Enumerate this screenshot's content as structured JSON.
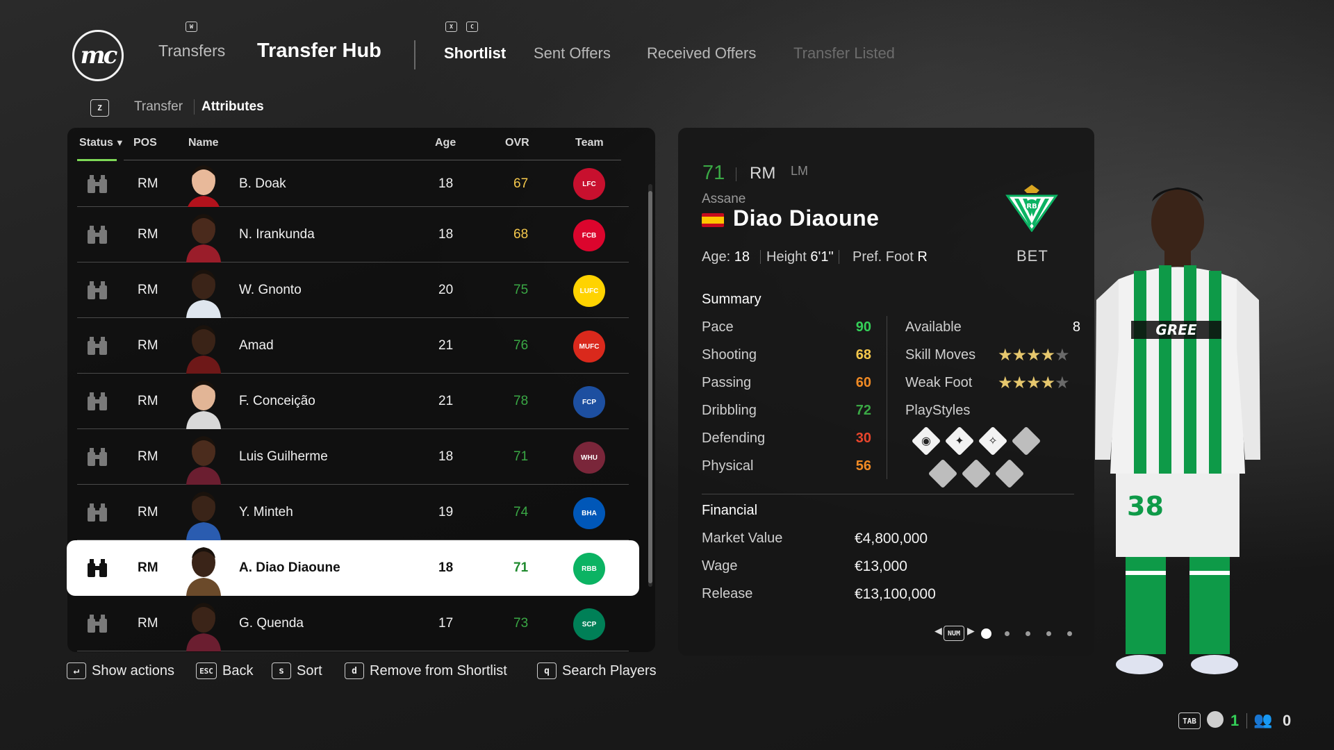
{
  "header": {
    "logo_text": "mc",
    "nav_key": "W",
    "transfers_label": "Transfers",
    "title": "Transfer Hub",
    "tab_keys": [
      "X",
      "C"
    ],
    "tabs": [
      {
        "label": "Shortlist",
        "state": "active"
      },
      {
        "label": "Sent Offers",
        "state": "normal"
      },
      {
        "label": "Received Offers",
        "state": "normal"
      },
      {
        "label": "Transfer Listed",
        "state": "disabled"
      }
    ]
  },
  "subnav": {
    "key": "Z",
    "items": [
      "Transfer",
      "Attributes"
    ],
    "active": "Attributes"
  },
  "list": {
    "columns": {
      "status": "Status",
      "sort_arrow": "▼",
      "pos": "POS",
      "name": "Name",
      "age": "Age",
      "ovr": "OVR",
      "team": "Team"
    },
    "rows": [
      {
        "pos": "RM",
        "name": "B. Doak",
        "age": "18",
        "ovr": "67",
        "ovr_color": "#f5c84c",
        "team": "LFC",
        "crest_color": "#c8102e",
        "skin": "#e8b99a",
        "shirt": "#b3121c",
        "selected": false
      },
      {
        "pos": "RM",
        "name": "N. Irankunda",
        "age": "18",
        "ovr": "68",
        "ovr_color": "#f5c84c",
        "team": "FCB",
        "crest_color": "#dc052d",
        "skin": "#4a2a1c",
        "shirt": "#9a1d2a",
        "selected": false
      },
      {
        "pos": "RM",
        "name": "W. Gnonto",
        "age": "20",
        "ovr": "75",
        "ovr_color": "#3aa845",
        "team": "LUFC",
        "crest_color": "#ffd300",
        "skin": "#3b2418",
        "shirt": "#dfe6ee",
        "selected": false
      },
      {
        "pos": "RM",
        "name": "Amad",
        "age": "21",
        "ovr": "76",
        "ovr_color": "#3aa845",
        "team": "MUFC",
        "crest_color": "#da291c",
        "skin": "#3a2317",
        "shirt": "#6e1818",
        "selected": false
      },
      {
        "pos": "RM",
        "name": "F. Conceição",
        "age": "21",
        "ovr": "78",
        "ovr_color": "#3aa845",
        "team": "FCP",
        "crest_color": "#1d4fa0",
        "skin": "#e2b596",
        "shirt": "#d8d8d8",
        "selected": false
      },
      {
        "pos": "RM",
        "name": "Luis Guilherme",
        "age": "18",
        "ovr": "71",
        "ovr_color": "#3aa845",
        "team": "WHU",
        "crest_color": "#7a263a",
        "skin": "#4b2c1d",
        "shirt": "#6b1e30",
        "selected": false
      },
      {
        "pos": "RM",
        "name": "Y. Minteh",
        "age": "19",
        "ovr": "74",
        "ovr_color": "#3aa845",
        "team": "BHA",
        "crest_color": "#0057b8",
        "skin": "#3a2418",
        "shirt": "#2a5cb0",
        "selected": false
      },
      {
        "pos": "RM",
        "name": "A. Diao Diaoune",
        "age": "18",
        "ovr": "71",
        "ovr_color": "#1f8a2e",
        "team": "RBB",
        "crest_color": "#0bb363",
        "skin": "#3a2418",
        "shirt": "#6b4a2a",
        "selected": true
      },
      {
        "pos": "RM",
        "name": "G. Quenda",
        "age": "17",
        "ovr": "73",
        "ovr_color": "#3aa845",
        "team": "SCP",
        "crest_color": "#008057",
        "skin": "#3b2418",
        "shirt": "#6b1e30",
        "selected": false
      }
    ]
  },
  "player": {
    "ovr": "71",
    "position": "RM",
    "alt_position": "LM",
    "first_name": "Assane",
    "last_name": "Diao Diaoune",
    "age_label": "Age:",
    "age": "18",
    "height_label": "Height",
    "height": "6'1\"",
    "foot_label": "Pref. Foot",
    "foot": "R",
    "club_code": "BET",
    "summary_title": "Summary",
    "attributes": [
      {
        "label": "Pace",
        "value": "90",
        "color": "#34d058"
      },
      {
        "label": "Shooting",
        "value": "68",
        "color": "#f5c84c"
      },
      {
        "label": "Passing",
        "value": "60",
        "color": "#f08a24"
      },
      {
        "label": "Dribbling",
        "value": "72",
        "color": "#3aa845"
      },
      {
        "label": "Defending",
        "value": "30",
        "color": "#e8452c"
      },
      {
        "label": "Physical",
        "value": "56",
        "color": "#f08a24"
      }
    ],
    "available_label": "Available",
    "available": "8",
    "skill_moves_label": "Skill Moves",
    "skill_moves": 4,
    "weak_foot_label": "Weak Foot",
    "weak_foot": 4,
    "stars_max": 5,
    "playstyles_label": "PlayStyles",
    "playstyle_icons": [
      "technical-icon",
      "acrobatic-icon",
      "trickster-icon"
    ],
    "playstyle_empty_slots": 4,
    "financial_title": "Financial",
    "financial": [
      {
        "label": "Market Value",
        "value": "€4,800,000"
      },
      {
        "label": "Wage",
        "value": "€13,000"
      },
      {
        "label": "Release",
        "value": "€13,100,000"
      }
    ],
    "pager_key": "NUM",
    "pages_total": 5,
    "page_current": 1
  },
  "footer": {
    "actions": [
      {
        "key": "↵",
        "label": "Show actions"
      },
      {
        "key": "ESC",
        "label": "Back"
      },
      {
        "key": "s",
        "label": "Sort"
      },
      {
        "key": "d",
        "label": "Remove from Shortlist"
      },
      {
        "key": "q",
        "label": "Search Players"
      }
    ],
    "tab_key": "TAB",
    "scout_count": "1",
    "user_count": "0"
  }
}
